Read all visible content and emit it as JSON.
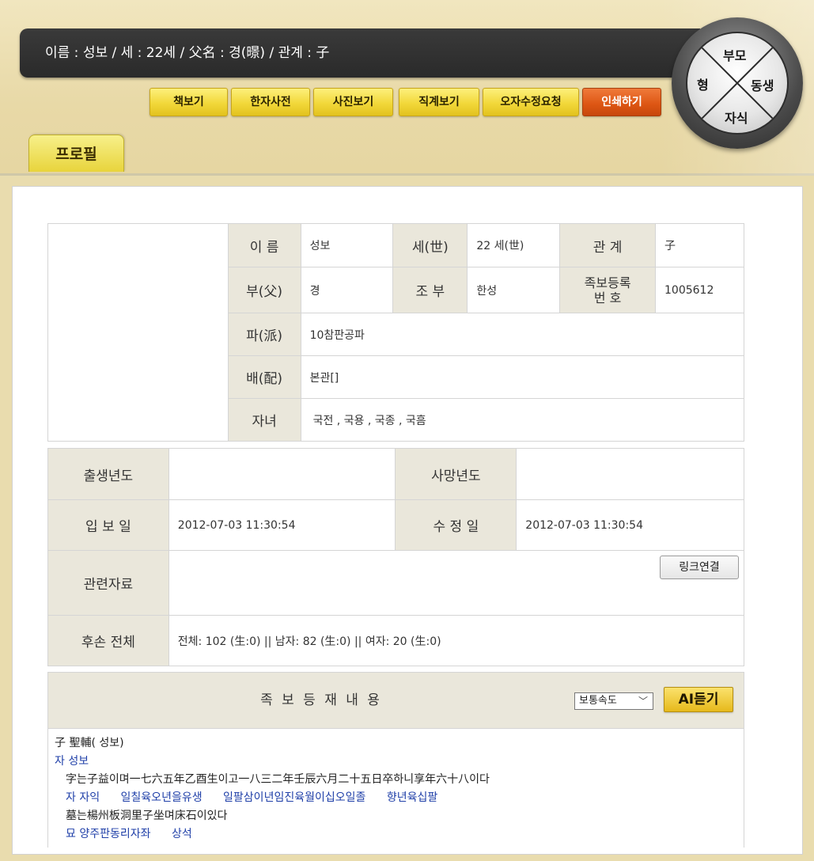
{
  "header": {
    "info_text": "이름 : 성보 /  세 : 22세  /  父名 : 경(暻)  /  관계 : 子",
    "buttons": [
      "책보기",
      "한자사전",
      "사진보기",
      "직계보기",
      "오자수정요청",
      "인쇄하기"
    ],
    "profile_tab": "프로필"
  },
  "family_nav": {
    "top": "부모",
    "left": "형",
    "right": "동생",
    "bottom": "자식"
  },
  "profile": {
    "name_label": "이   름",
    "name": "성보",
    "generation_label": "세(世)",
    "generation": "22 세(世)",
    "relation_label": "관   계",
    "relation": "子",
    "father_label": "부(父)",
    "father": "경",
    "grandfather_label": "조   부",
    "grandfather": "한성",
    "reg_label_line1": "족보등록",
    "reg_label_line2": "번      호",
    "reg_no": "1005612",
    "branch_label": "파(派)",
    "branch": "10참판공파",
    "spouse_label": "배(配)",
    "spouse": "본관[]",
    "children_label": "자녀",
    "children": "국전 , 국용 , 국종 , 국흠"
  },
  "details": {
    "birth_label": "출생년도",
    "birth": "",
    "death_label": "사망년도",
    "death": "",
    "entered_label": "입 보 일",
    "entered": "2012-07-03 11:30:54",
    "modified_label": "수 정 일",
    "modified": "2012-07-03 11:30:54",
    "related_label": "관련자료",
    "link_button": "링크연결",
    "descendants_label": "후손 전체",
    "descendants": "전체: 102 (生:0)  ||  남자: 82 (生:0)  ||  여자: 20 (生:0)"
  },
  "jokbo": {
    "title": "족 보 등 재 내 용",
    "speed_selected": "보통속도",
    "ai_button": "AI듣기",
    "line1": "子 聖輔( 성보)",
    "line2": "자 성보",
    "line3": "字는子益이며一七六五年乙酉生이고一八三二年壬辰六月二十五日卒하니享年六十八이다",
    "line4_items": [
      "자  자익",
      "일칠육오년을유생",
      "일팔삼이년임진육월이십오일졸",
      "향년육십팔"
    ],
    "line5": "墓는楊州板洞里子坐며床石이있다",
    "line6_items": [
      "묘  양주판동리자좌",
      "상석"
    ]
  },
  "colors": {
    "header_bg": "#e8d9a7",
    "info_bar": "#2f2f2f",
    "button_yellow": "#f2d83a",
    "button_print": "#dc5513",
    "label_bg": "#eae7db",
    "blue_text": "#1f3fa8"
  }
}
